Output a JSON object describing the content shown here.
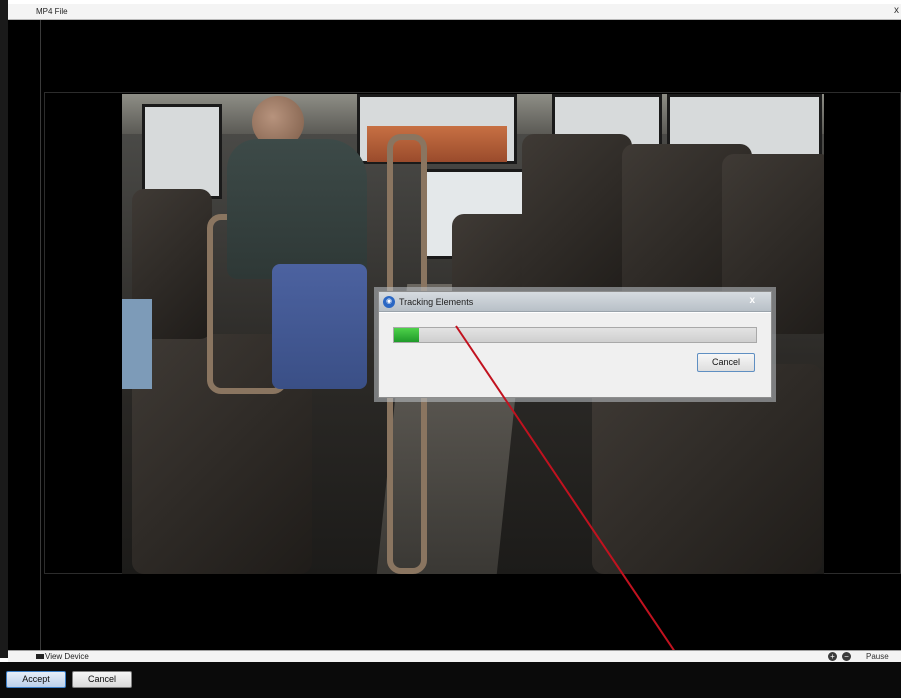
{
  "window": {
    "title": "MP4 File",
    "close_glyph": "x"
  },
  "dialog": {
    "title": "Tracking Elements",
    "icon": "app-logo-icon",
    "close_glyph": "x",
    "progress": 0.07,
    "cancel_label": "Cancel"
  },
  "status_bar": {
    "device_label": "View Device",
    "zoom_in_icon": "plus-circle-icon",
    "zoom_out_icon": "minus-circle-icon",
    "pause_label": "Pause"
  },
  "actions": {
    "accept_label": "Accept",
    "cancel_label": "Cancel"
  },
  "colors": {
    "progress": "#2bb03a",
    "annotation_line": "#c1121f",
    "accent": "#3c7fc7"
  }
}
